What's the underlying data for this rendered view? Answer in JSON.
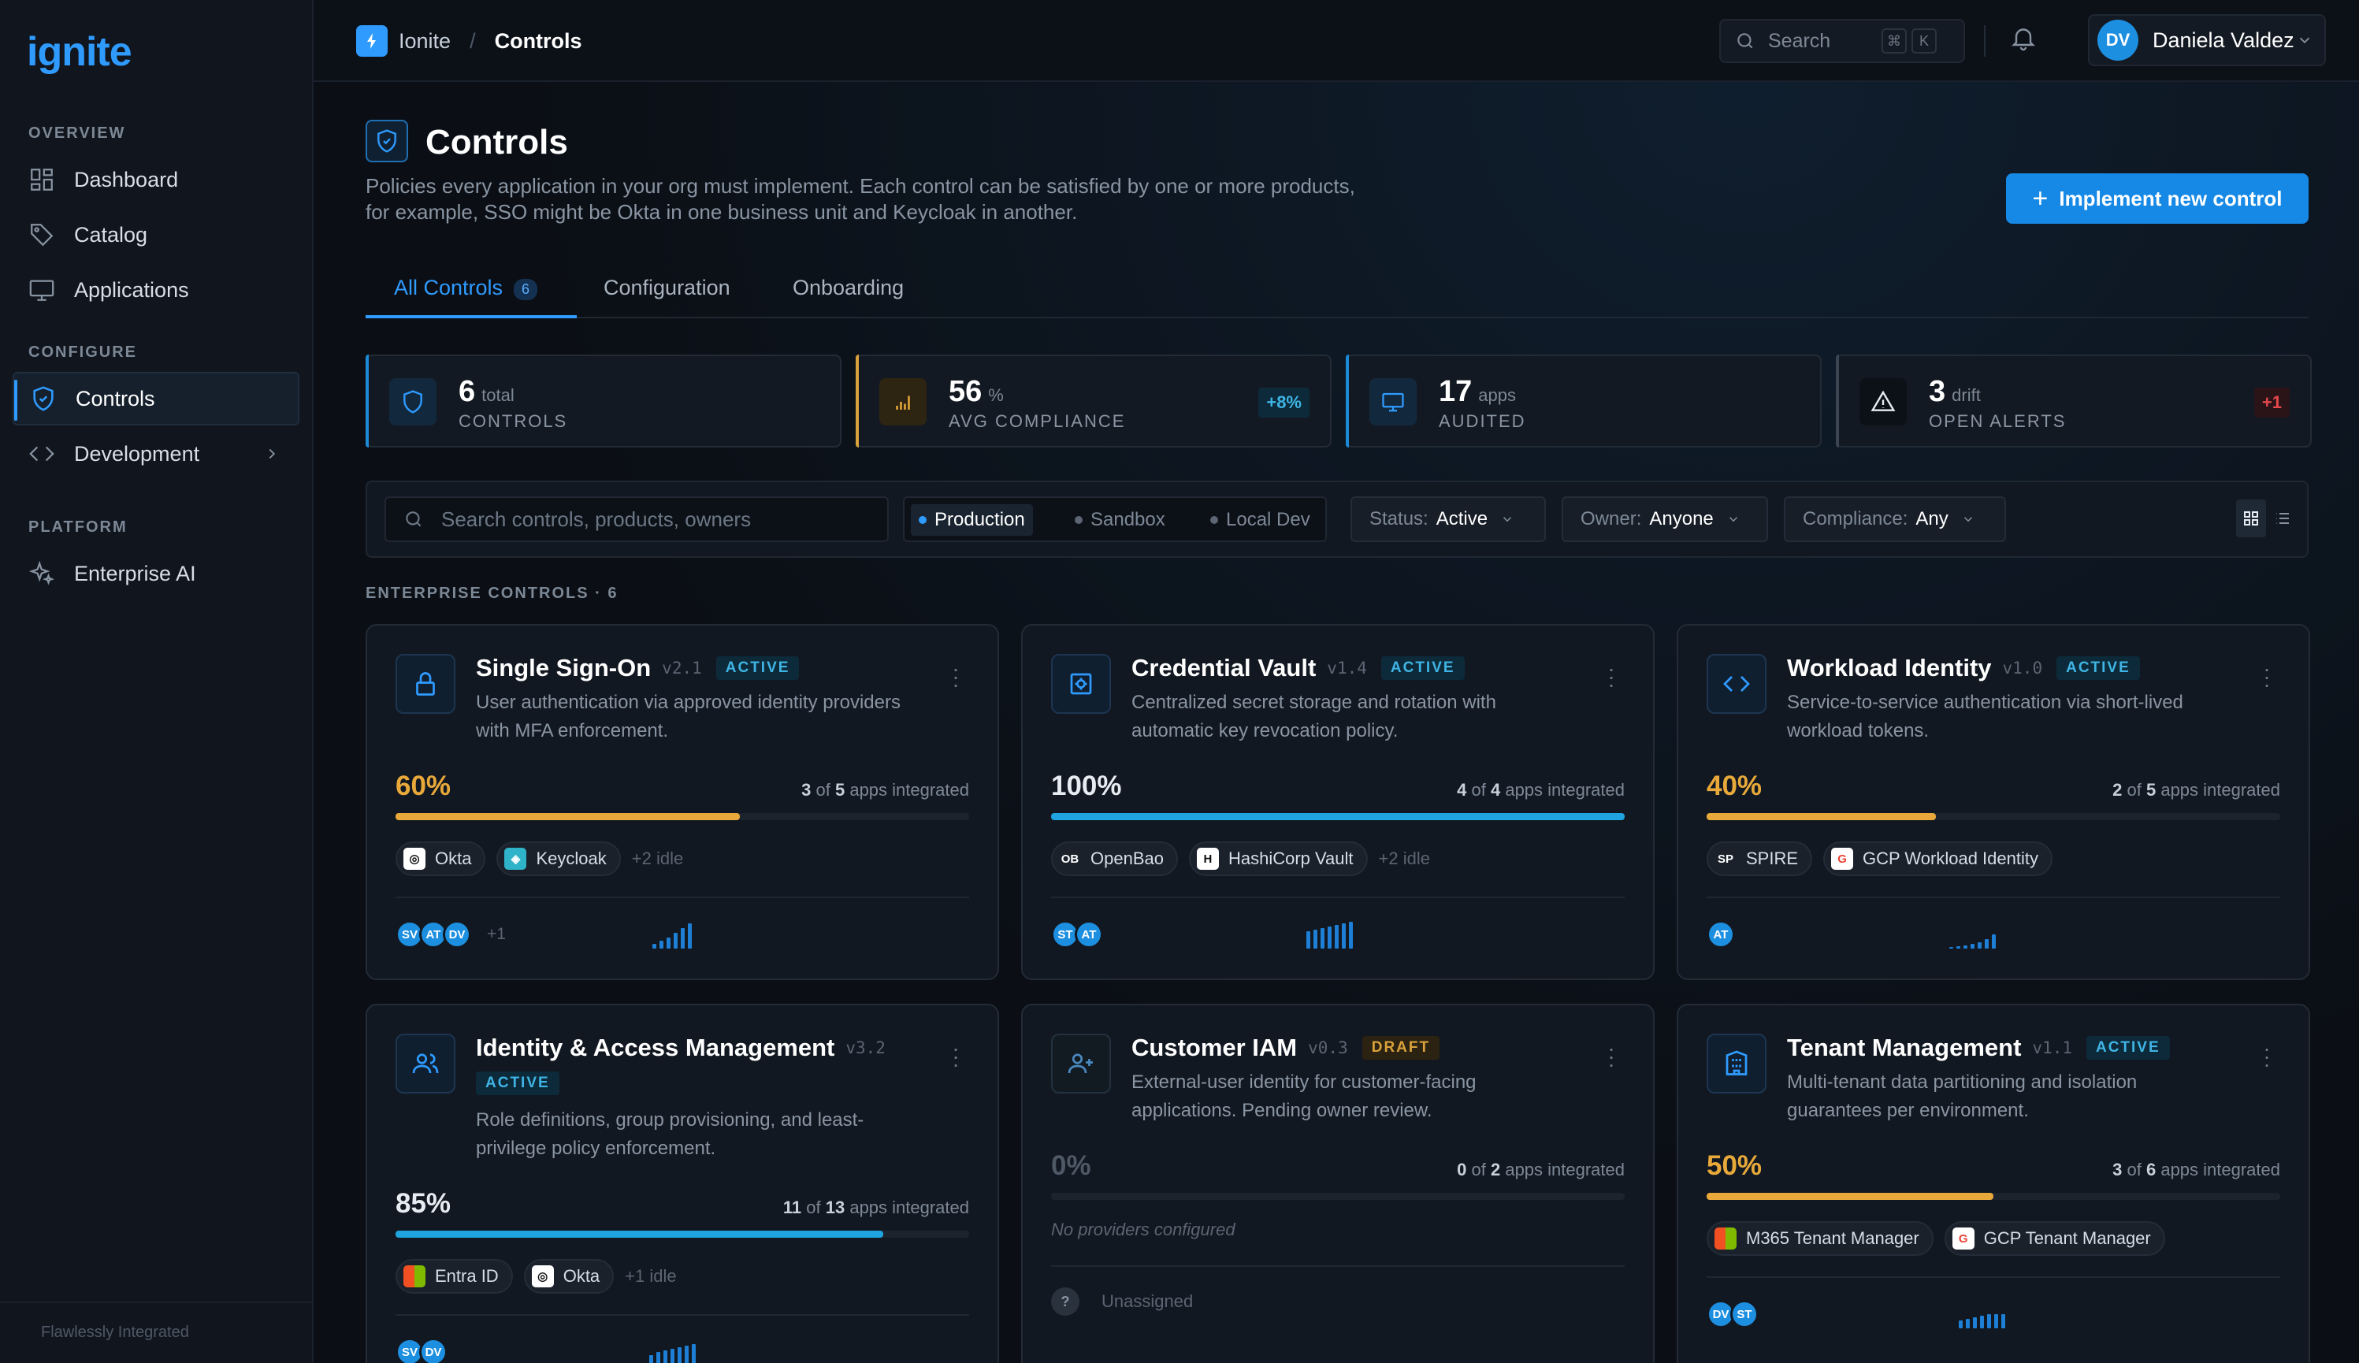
{
  "app": {
    "logo": "ignite",
    "footer": "Flawlessly Integrated"
  },
  "sidebar": {
    "sections": [
      "OVERVIEW",
      "CONFIGURE",
      "PLATFORM"
    ],
    "items": [
      {
        "label": "Dashboard",
        "icon": "grid-icon"
      },
      {
        "label": "Catalog",
        "icon": "tag-icon"
      },
      {
        "label": "Applications",
        "icon": "monitor-icon"
      },
      {
        "label": "Controls",
        "icon": "shield-icon",
        "active": true
      },
      {
        "label": "Development",
        "icon": "code-icon"
      },
      {
        "label": "Enterprise AI",
        "icon": "sparkle-icon"
      }
    ]
  },
  "topbar": {
    "breadcrumb": [
      "Ionite",
      "/",
      "Controls"
    ],
    "search_placeholder": "Search",
    "kbd": [
      "⌘",
      "K"
    ],
    "user": {
      "initials": "DV",
      "name": "Daniela Valdez"
    }
  },
  "page": {
    "title": "Controls",
    "description": "Policies every application in your org must implement. Each control can be satisfied by one or more products, for example, SSO might be Okta in one business unit and Keycloak in another.",
    "cta": "Implement new control",
    "tabs": [
      {
        "label": "All Controls",
        "count": "6"
      },
      {
        "label": "Configuration"
      },
      {
        "label": "Onboarding"
      }
    ]
  },
  "stats": [
    {
      "value": "6",
      "unit": "total",
      "label": "CONTROLS",
      "delta": ""
    },
    {
      "value": "56",
      "unit": "%",
      "label": "AVG COMPLIANCE",
      "delta": "+8%"
    },
    {
      "value": "17",
      "unit": "apps",
      "label": "AUDITED",
      "delta": ""
    },
    {
      "value": "3",
      "unit": "drift",
      "label": "OPEN ALERTS",
      "delta": "+1"
    }
  ],
  "filters": {
    "search_placeholder": "Search controls, products, owners",
    "envs": [
      "Production",
      "Sandbox",
      "Local Dev"
    ],
    "status": {
      "label": "Status:",
      "value": "Active"
    },
    "owner": {
      "label": "Owner:",
      "value": "Anyone"
    },
    "compliance": {
      "label": "Compliance:",
      "value": "Any"
    }
  },
  "section_label": "ENTERPRISE CONTROLS · 6",
  "colors": {
    "accent": "#2f9bff",
    "amber": "#e8a93a",
    "cyan": "#1fa4e0",
    "danger": "#e5484d"
  },
  "cards": [
    {
      "title": "Single Sign-On",
      "version": "v2.1",
      "status": "ACTIVE",
      "icon": "lock-icon",
      "desc": "User authentication via approved identity providers with MFA enforcement.",
      "pct": "60%",
      "pct_value": 0.6,
      "of_a": "3",
      "of_mid": "of",
      "of_b": "5",
      "of_tail": "apps integrated",
      "providers": [
        {
          "mark": "◎",
          "name": "Okta"
        },
        {
          "mark": "◈",
          "name": "Keycloak"
        }
      ],
      "idle": "+2 idle",
      "owners": [
        "SV",
        "AT",
        "DV"
      ],
      "owners_more": "+1"
    },
    {
      "title": "Credential Vault",
      "version": "v1.4",
      "status": "ACTIVE",
      "icon": "vault-icon",
      "desc": "Centralized secret storage and rotation with automatic key revocation policy.",
      "pct": "100%",
      "pct_value": 1.0,
      "of_a": "4",
      "of_mid": "of",
      "of_b": "4",
      "of_tail": "apps integrated",
      "providers": [
        {
          "mark": "OB",
          "name": "OpenBao"
        },
        {
          "mark": "H",
          "name": "HashiCorp Vault"
        }
      ],
      "idle": "+2 idle",
      "owners": [
        "ST",
        "AT"
      ],
      "owners_more": ""
    },
    {
      "title": "Workload Identity",
      "version": "v1.0",
      "status": "ACTIVE",
      "icon": "code-icon",
      "desc": "Service-to-service authentication via short-lived workload tokens.",
      "pct": "40%",
      "pct_value": 0.4,
      "of_a": "2",
      "of_mid": "of",
      "of_b": "5",
      "of_tail": "apps integrated",
      "providers": [
        {
          "mark": "SP",
          "name": "SPIRE"
        },
        {
          "mark": "G",
          "name": "GCP Workload Identity"
        }
      ],
      "idle": "",
      "owners": [
        "AT"
      ],
      "owners_more": ""
    },
    {
      "title": "Identity & Access Management",
      "version": "v3.2",
      "status": "ACTIVE",
      "icon": "users-icon",
      "desc": "Role definitions, group provisioning, and least-privilege policy enforcement.",
      "pct": "85%",
      "pct_value": 0.85,
      "of_a": "11",
      "of_mid": "of",
      "of_b": "13",
      "of_tail": "apps integrated",
      "providers": [
        {
          "mark": "⊞",
          "name": "Entra ID"
        },
        {
          "mark": "◎",
          "name": "Okta"
        }
      ],
      "idle": "+1 idle",
      "owners": [
        "SV",
        "DV"
      ],
      "owners_more": ""
    },
    {
      "title": "Customer IAM",
      "version": "v0.3",
      "status": "DRAFT",
      "icon": "user-plus-icon",
      "desc": "External-user identity for customer-facing applications. Pending owner review.",
      "pct": "0%",
      "pct_value": 0,
      "of_a": "0",
      "of_mid": "of",
      "of_b": "2",
      "of_tail": "apps integrated",
      "no_providers": "No providers configured",
      "unassigned": "Unassigned"
    },
    {
      "title": "Tenant Management",
      "version": "v1.1",
      "status": "ACTIVE",
      "icon": "building-icon",
      "desc": "Multi-tenant data partitioning and isolation guarantees per environment.",
      "pct": "50%",
      "pct_value": 0.5,
      "of_a": "3",
      "of_mid": "of",
      "of_b": "6",
      "of_tail": "apps integrated",
      "providers": [
        {
          "mark": "⊞",
          "name": "M365 Tenant Manager"
        },
        {
          "mark": "G",
          "name": "GCP Tenant Manager"
        }
      ],
      "idle": "",
      "owners": [
        "DV",
        "ST"
      ],
      "owners_more": ""
    }
  ]
}
